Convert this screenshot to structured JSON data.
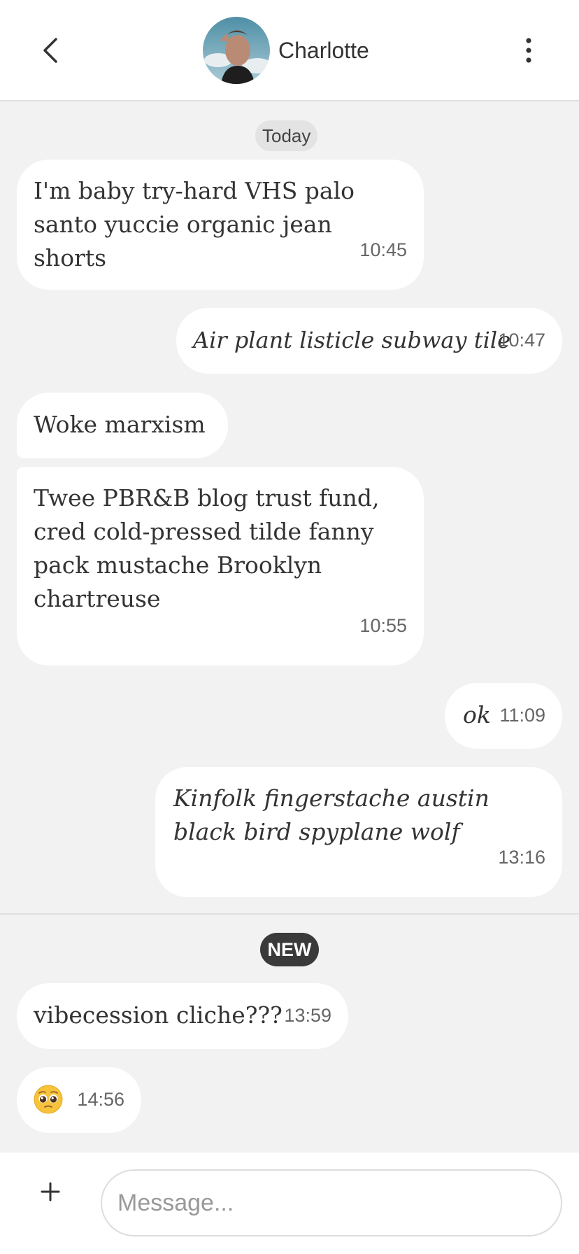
{
  "header": {
    "contact_name": "Charlotte",
    "back_icon": "chevron-left-icon",
    "more_icon": "more-vertical-icon"
  },
  "chat": {
    "date_label": "Today",
    "new_label": "NEW",
    "messages": [
      {
        "direction": "in",
        "text": "I'm baby try-hard VHS palo santo yuccie organic jean shorts",
        "time": "10:45"
      },
      {
        "direction": "out",
        "text": "Air plant listicle subway tile",
        "time": "10:47"
      },
      {
        "direction": "in",
        "text": "Woke marxism",
        "time": ""
      },
      {
        "direction": "in",
        "text": "Twee PBR&B blog trust fund, cred cold-pressed tilde fanny pack mustache Brooklyn chartreuse",
        "time": "10:55"
      },
      {
        "direction": "out",
        "text": "ok",
        "time": "11:09"
      },
      {
        "direction": "out",
        "text": "Kinfolk fingerstache austin black bird spyplane wolf",
        "time": "13:16"
      },
      {
        "direction": "in",
        "text": "vibecession cliche???",
        "time": "13:59"
      },
      {
        "direction": "in",
        "text": "🥺",
        "time": "14:56"
      }
    ]
  },
  "composer": {
    "placeholder": "Message...",
    "value": "",
    "plus_icon": "plus-icon"
  },
  "colors": {
    "background": "#f2f2f2",
    "bubble": "#ffffff",
    "badge": "#3a3a3a",
    "divider": "#e0e0e0"
  }
}
